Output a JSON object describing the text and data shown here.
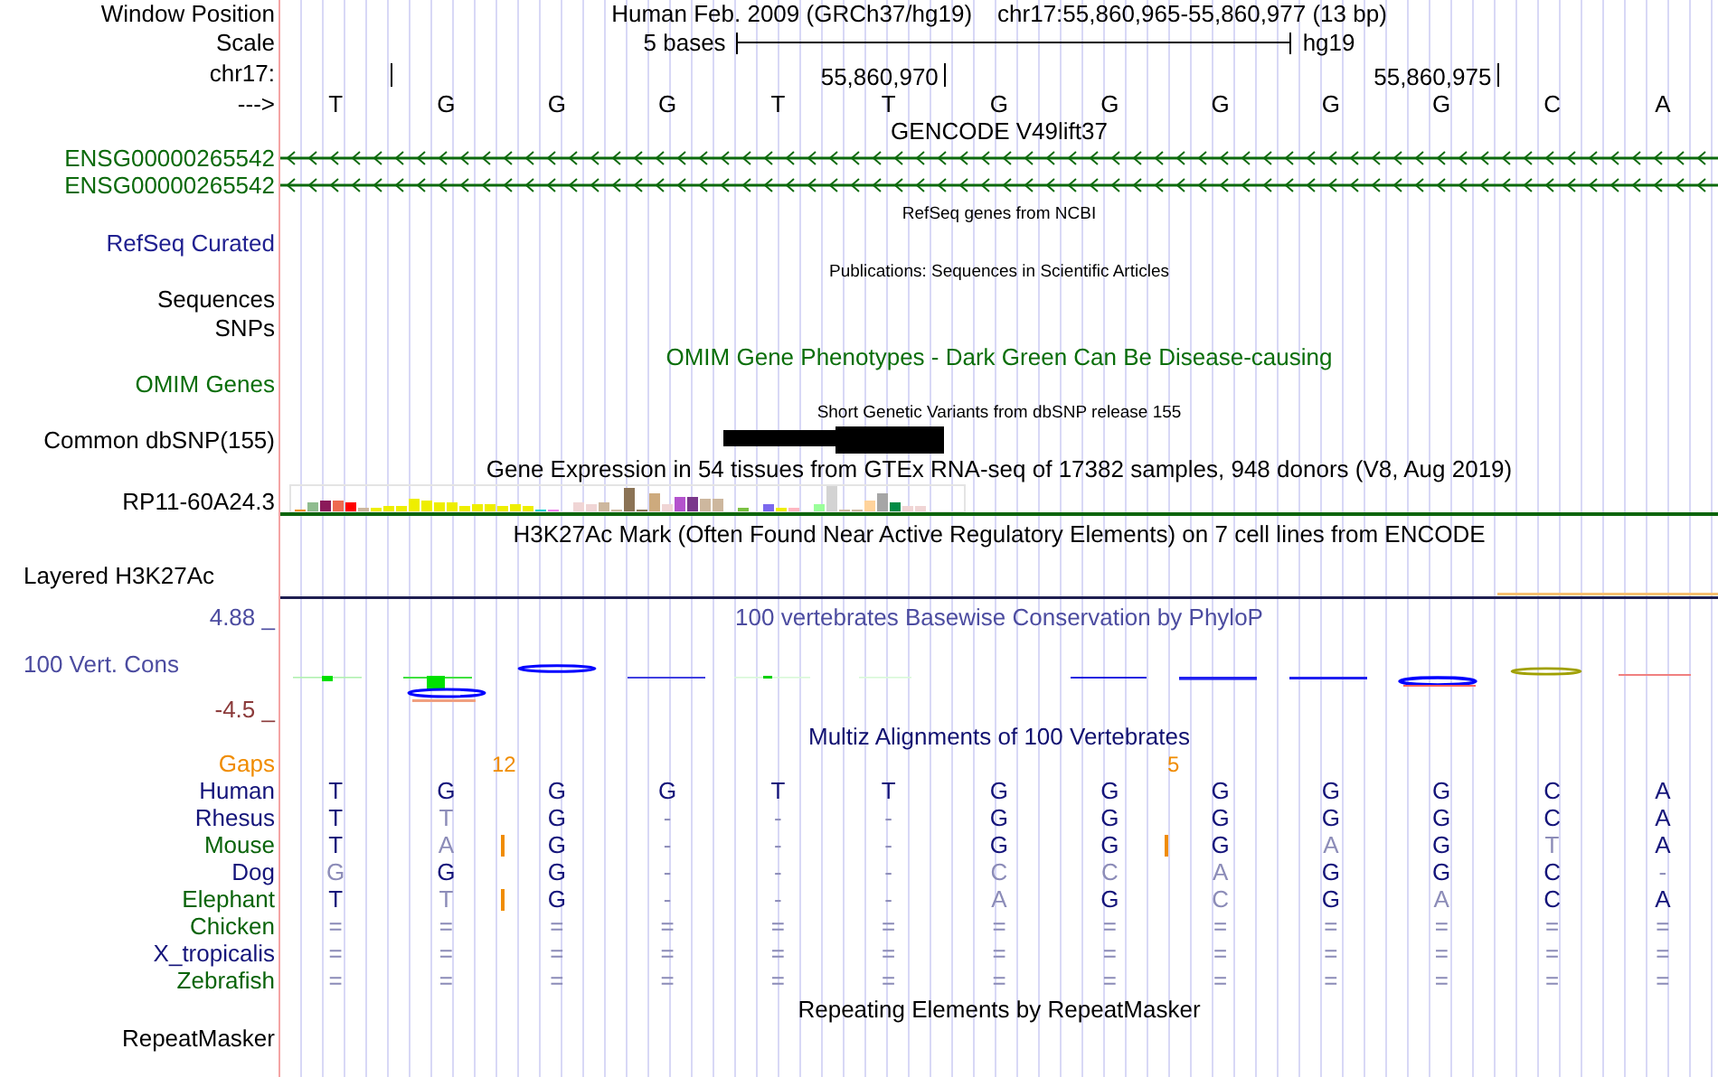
{
  "position": {
    "label": "Window Position",
    "assembly": "Human Feb. 2009 (GRCh37/hg19)",
    "range": "chr17:55,860,965-55,860,977 (13 bp)"
  },
  "scale": {
    "label": "Scale",
    "text": "5 bases",
    "assembly": "hg19"
  },
  "ruler": {
    "label": "chr17:",
    "ticks": [
      "55,860,970",
      "55,860,975"
    ]
  },
  "sequence": {
    "label": "--->",
    "bases": [
      "T",
      "G",
      "G",
      "G",
      "T",
      "T",
      "G",
      "G",
      "G",
      "G",
      "G",
      "C",
      "A"
    ]
  },
  "gencode": {
    "title": "GENCODE V49lift37",
    "transcripts": [
      "ENSG00000265542",
      "ENSG00000265542"
    ]
  },
  "refseq": {
    "title": "RefSeq genes from NCBI",
    "label": "RefSeq Curated"
  },
  "publications": {
    "title": "Publications: Sequences in Scientific Articles",
    "label": "Sequences"
  },
  "snps": {
    "label": "SNPs"
  },
  "omim": {
    "title": "OMIM Gene Phenotypes - Dark Green Can Be Disease-causing",
    "label": "OMIM Genes"
  },
  "dbsnp": {
    "title": "Short Genetic Variants from dbSNP release 155",
    "label": "Common dbSNP(155)"
  },
  "gtex": {
    "title": "Gene Expression in 54 tissues from GTEx RNA-seq of 17382 samples, 948 donors (V8, Aug 2019)",
    "label": "RP11-60A24.3"
  },
  "h3k27ac": {
    "title": "H3K27Ac Mark (Often Found Near Active Regulatory Elements) on 7 cell lines from ENCODE",
    "label": "Layered H3K27Ac"
  },
  "phylop": {
    "title": "100 vertebrates Basewise Conservation by PhyloP",
    "label": "100 Vert. Cons",
    "max": "4.88 _",
    "min": "-4.5 _"
  },
  "multiz": {
    "title": "Multiz Alignments of 100 Vertebrates",
    "gaps_label": "Gaps",
    "species": [
      {
        "name": "Human",
        "color": "#14147a"
      },
      {
        "name": "Rhesus",
        "color": "#14147a"
      },
      {
        "name": "Mouse",
        "color": "#0a640a"
      },
      {
        "name": "Dog",
        "color": "#14147a"
      },
      {
        "name": "Elephant",
        "color": "#0a640a"
      },
      {
        "name": "Chicken",
        "color": "#0a640a"
      },
      {
        "name": "X_tropicalis",
        "color": "#14147a"
      },
      {
        "name": "Zebrafish",
        "color": "#0a640a"
      }
    ],
    "columns": [
      {
        "bases": [
          "T",
          "T",
          "T",
          "G",
          "T",
          "=",
          "=",
          "="
        ]
      },
      {
        "bases": [
          "G",
          "T",
          "A",
          "G",
          "T",
          "=",
          "=",
          "="
        ],
        "gap_after": {
          "label": "12",
          "marks": [
            false,
            false,
            true,
            false,
            true,
            false,
            false,
            false
          ]
        }
      },
      {
        "bases": [
          "G",
          "G",
          "G",
          "G",
          "G",
          "=",
          "=",
          "="
        ]
      },
      {
        "bases": [
          "G",
          "-",
          "-",
          "-",
          "-",
          "=",
          "=",
          "="
        ]
      },
      {
        "bases": [
          "T",
          "-",
          "-",
          "-",
          "-",
          "=",
          "=",
          "="
        ]
      },
      {
        "bases": [
          "T",
          "-",
          "-",
          "-",
          "-",
          "=",
          "=",
          "="
        ]
      },
      {
        "bases": [
          "G",
          "G",
          "G",
          "C",
          "A",
          "=",
          "=",
          "="
        ]
      },
      {
        "bases": [
          "G",
          "G",
          "G",
          "C",
          "G",
          "=",
          "=",
          "="
        ],
        "gap_after": {
          "label": "5",
          "marks": [
            false,
            false,
            true,
            false,
            false,
            false,
            false,
            false
          ]
        }
      },
      {
        "bases": [
          "G",
          "G",
          "G",
          "A",
          "C",
          "=",
          "=",
          "="
        ]
      },
      {
        "bases": [
          "G",
          "G",
          "A",
          "G",
          "G",
          "=",
          "=",
          "="
        ]
      },
      {
        "bases": [
          "G",
          "G",
          "G",
          "G",
          "A",
          "=",
          "=",
          "="
        ]
      },
      {
        "bases": [
          "C",
          "C",
          "T",
          "C",
          "C",
          "=",
          "=",
          "="
        ]
      },
      {
        "bases": [
          "A",
          "A",
          "A",
          "-",
          "A",
          "=",
          "=",
          "="
        ]
      }
    ]
  },
  "repeatmasker": {
    "title": "Repeating Elements by RepeatMasker",
    "label": "RepeatMasker"
  }
}
